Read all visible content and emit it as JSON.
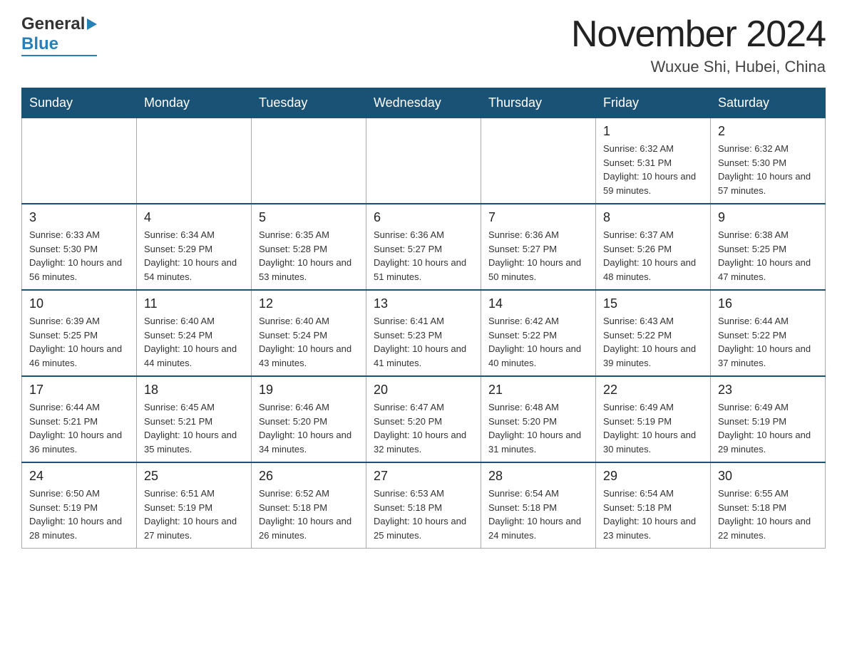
{
  "header": {
    "month_title": "November 2024",
    "location": "Wuxue Shi, Hubei, China",
    "logo_general": "General",
    "logo_blue": "Blue"
  },
  "days_of_week": [
    "Sunday",
    "Monday",
    "Tuesday",
    "Wednesday",
    "Thursday",
    "Friday",
    "Saturday"
  ],
  "weeks": [
    {
      "days": [
        {
          "number": "",
          "info": ""
        },
        {
          "number": "",
          "info": ""
        },
        {
          "number": "",
          "info": ""
        },
        {
          "number": "",
          "info": ""
        },
        {
          "number": "",
          "info": ""
        },
        {
          "number": "1",
          "info": "Sunrise: 6:32 AM\nSunset: 5:31 PM\nDaylight: 10 hours\nand 59 minutes."
        },
        {
          "number": "2",
          "info": "Sunrise: 6:32 AM\nSunset: 5:30 PM\nDaylight: 10 hours\nand 57 minutes."
        }
      ]
    },
    {
      "days": [
        {
          "number": "3",
          "info": "Sunrise: 6:33 AM\nSunset: 5:30 PM\nDaylight: 10 hours\nand 56 minutes."
        },
        {
          "number": "4",
          "info": "Sunrise: 6:34 AM\nSunset: 5:29 PM\nDaylight: 10 hours\nand 54 minutes."
        },
        {
          "number": "5",
          "info": "Sunrise: 6:35 AM\nSunset: 5:28 PM\nDaylight: 10 hours\nand 53 minutes."
        },
        {
          "number": "6",
          "info": "Sunrise: 6:36 AM\nSunset: 5:27 PM\nDaylight: 10 hours\nand 51 minutes."
        },
        {
          "number": "7",
          "info": "Sunrise: 6:36 AM\nSunset: 5:27 PM\nDaylight: 10 hours\nand 50 minutes."
        },
        {
          "number": "8",
          "info": "Sunrise: 6:37 AM\nSunset: 5:26 PM\nDaylight: 10 hours\nand 48 minutes."
        },
        {
          "number": "9",
          "info": "Sunrise: 6:38 AM\nSunset: 5:25 PM\nDaylight: 10 hours\nand 47 minutes."
        }
      ]
    },
    {
      "days": [
        {
          "number": "10",
          "info": "Sunrise: 6:39 AM\nSunset: 5:25 PM\nDaylight: 10 hours\nand 46 minutes."
        },
        {
          "number": "11",
          "info": "Sunrise: 6:40 AM\nSunset: 5:24 PM\nDaylight: 10 hours\nand 44 minutes."
        },
        {
          "number": "12",
          "info": "Sunrise: 6:40 AM\nSunset: 5:24 PM\nDaylight: 10 hours\nand 43 minutes."
        },
        {
          "number": "13",
          "info": "Sunrise: 6:41 AM\nSunset: 5:23 PM\nDaylight: 10 hours\nand 41 minutes."
        },
        {
          "number": "14",
          "info": "Sunrise: 6:42 AM\nSunset: 5:22 PM\nDaylight: 10 hours\nand 40 minutes."
        },
        {
          "number": "15",
          "info": "Sunrise: 6:43 AM\nSunset: 5:22 PM\nDaylight: 10 hours\nand 39 minutes."
        },
        {
          "number": "16",
          "info": "Sunrise: 6:44 AM\nSunset: 5:22 PM\nDaylight: 10 hours\nand 37 minutes."
        }
      ]
    },
    {
      "days": [
        {
          "number": "17",
          "info": "Sunrise: 6:44 AM\nSunset: 5:21 PM\nDaylight: 10 hours\nand 36 minutes."
        },
        {
          "number": "18",
          "info": "Sunrise: 6:45 AM\nSunset: 5:21 PM\nDaylight: 10 hours\nand 35 minutes."
        },
        {
          "number": "19",
          "info": "Sunrise: 6:46 AM\nSunset: 5:20 PM\nDaylight: 10 hours\nand 34 minutes."
        },
        {
          "number": "20",
          "info": "Sunrise: 6:47 AM\nSunset: 5:20 PM\nDaylight: 10 hours\nand 32 minutes."
        },
        {
          "number": "21",
          "info": "Sunrise: 6:48 AM\nSunset: 5:20 PM\nDaylight: 10 hours\nand 31 minutes."
        },
        {
          "number": "22",
          "info": "Sunrise: 6:49 AM\nSunset: 5:19 PM\nDaylight: 10 hours\nand 30 minutes."
        },
        {
          "number": "23",
          "info": "Sunrise: 6:49 AM\nSunset: 5:19 PM\nDaylight: 10 hours\nand 29 minutes."
        }
      ]
    },
    {
      "days": [
        {
          "number": "24",
          "info": "Sunrise: 6:50 AM\nSunset: 5:19 PM\nDaylight: 10 hours\nand 28 minutes."
        },
        {
          "number": "25",
          "info": "Sunrise: 6:51 AM\nSunset: 5:19 PM\nDaylight: 10 hours\nand 27 minutes."
        },
        {
          "number": "26",
          "info": "Sunrise: 6:52 AM\nSunset: 5:18 PM\nDaylight: 10 hours\nand 26 minutes."
        },
        {
          "number": "27",
          "info": "Sunrise: 6:53 AM\nSunset: 5:18 PM\nDaylight: 10 hours\nand 25 minutes."
        },
        {
          "number": "28",
          "info": "Sunrise: 6:54 AM\nSunset: 5:18 PM\nDaylight: 10 hours\nand 24 minutes."
        },
        {
          "number": "29",
          "info": "Sunrise: 6:54 AM\nSunset: 5:18 PM\nDaylight: 10 hours\nand 23 minutes."
        },
        {
          "number": "30",
          "info": "Sunrise: 6:55 AM\nSunset: 5:18 PM\nDaylight: 10 hours\nand 22 minutes."
        }
      ]
    }
  ]
}
